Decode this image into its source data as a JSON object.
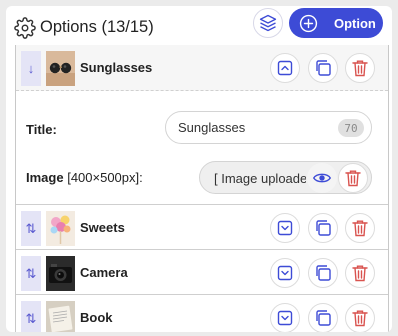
{
  "header": {
    "title": "Options (13/15)",
    "add_button_label": "Option",
    "icons": {
      "settings": "gear-icon",
      "layers": "layers-icon",
      "add": "plus-circle-icon"
    }
  },
  "options": [
    {
      "title": "Sunglasses",
      "expanded": true,
      "handle_glyph": "↓",
      "thumbnail": "sunglasses"
    },
    {
      "title": "Sweets",
      "expanded": false,
      "handle_glyph": "⇅",
      "thumbnail": "sweets"
    },
    {
      "title": "Camera",
      "expanded": false,
      "handle_glyph": "⇅",
      "thumbnail": "camera"
    },
    {
      "title": "Book",
      "expanded": false,
      "handle_glyph": "⇅",
      "thumbnail": "book"
    }
  ],
  "detail": {
    "title_label": "Title:",
    "title_value": "Sunglasses",
    "title_remaining": "70",
    "image_label": "Image",
    "image_size_hint": "[400×500px]:",
    "image_value": "[ Image uploaded ]"
  },
  "colors": {
    "accent": "#3d4bd6",
    "danger": "#d9534f",
    "handle_bg": "#e4e4f6"
  }
}
